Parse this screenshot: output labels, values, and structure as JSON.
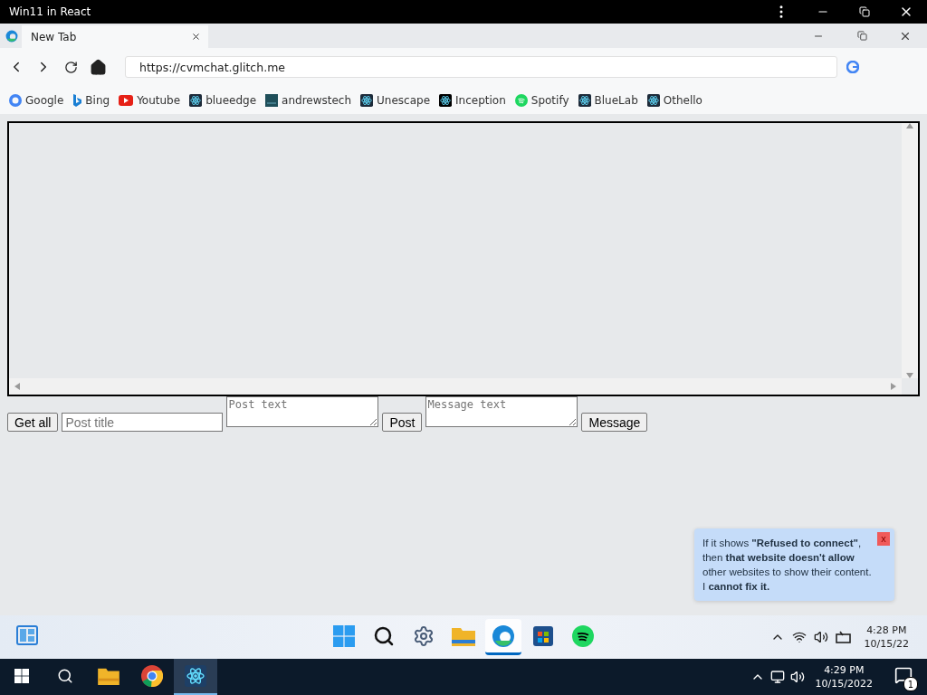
{
  "host_window": {
    "title": "Win11 in React"
  },
  "browser": {
    "tab": {
      "label": "New Tab",
      "selected": true
    },
    "url": "https://cvmchat.glitch.me",
    "bookmarks": [
      "Google",
      "Bing",
      "Youtube",
      "blueedge",
      "andrewstech",
      "Unescape",
      "Inception",
      "Spotify",
      "BlueLab",
      "Othello"
    ]
  },
  "page": {
    "buttons": [
      "Get all",
      "Post",
      "Message"
    ],
    "post_title": {
      "placeholder": "Post title"
    },
    "post_text": {
      "placeholder": "Post text"
    },
    "message_text": {
      "placeholder": "Message text"
    }
  },
  "toast": {
    "text": "If it shows **\"Refused to connect\"**, then **that website doesn't allow** other websites to show their content. I **cannot fix it.**",
    "close": "x"
  },
  "win11_taskbar": {
    "apps": [
      {
        "selected": false
      },
      {
        "selected": false
      },
      {
        "selected": false
      },
      {
        "selected": false
      },
      {
        "selected": true
      },
      {
        "selected": false
      },
      {
        "selected": false
      }
    ],
    "time": "4:28 PM",
    "date": "10/15/22"
  },
  "host_taskbar": {
    "apps": [
      {
        "selected": false
      },
      {
        "selected": false
      },
      {
        "selected": false
      },
      {
        "selected": false
      },
      {
        "selected": true
      }
    ],
    "time": "4:29 PM",
    "date": "10/15/2022",
    "notifications": "1"
  }
}
